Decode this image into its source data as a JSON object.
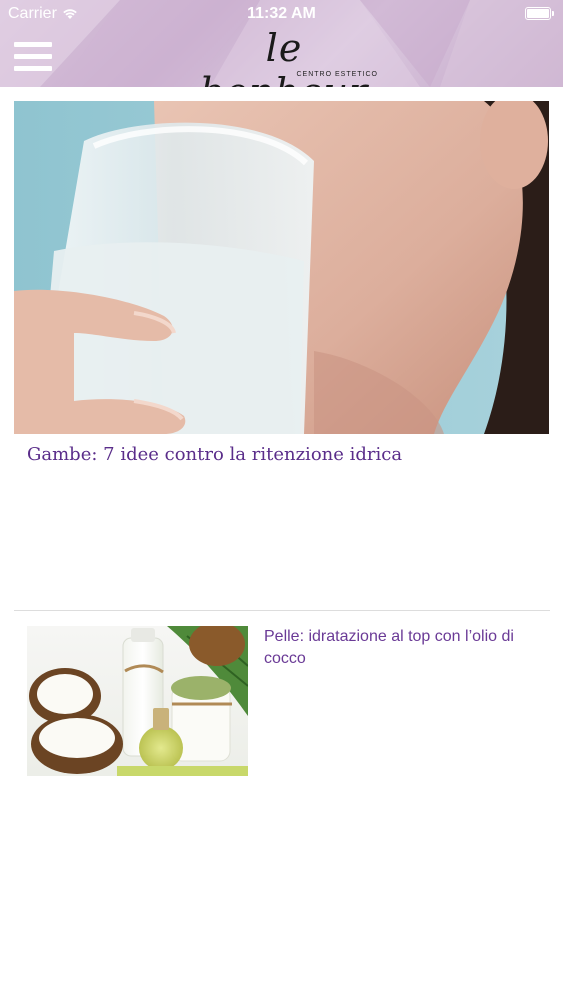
{
  "status_bar": {
    "carrier": "Carrier",
    "time": "11:32 AM",
    "wifi_icon": "wifi-icon",
    "battery_icon": "battery-icon"
  },
  "header": {
    "menu_icon": "hamburger-menu-icon",
    "logo_text": "le bonheur",
    "logo_subtitle": "CENTRO ESTETICO"
  },
  "articles": [
    {
      "title": "Gambe: 7 idee contro la ritenzione idrica",
      "image": "woman-drinking-water-photo"
    },
    {
      "title": "Pelle: idratazione al top con l’olio di cocco",
      "image": "coconut-oil-photo"
    }
  ],
  "colors": {
    "header_gradient_start": "#d9c4dc",
    "header_gradient_end": "#c3a6c8",
    "hero_title": "#5a2d8a",
    "card_title": "#6a3a96",
    "divider": "#dddddd"
  }
}
